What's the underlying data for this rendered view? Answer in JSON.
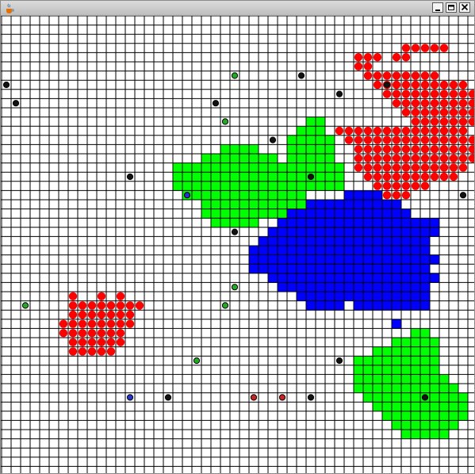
{
  "window": {
    "title": ""
  },
  "icons": {
    "app": "java-cup-icon",
    "minimize": "minimize-icon",
    "maximize": "maximize-icon",
    "close": "close-icon"
  },
  "colors": {
    "grid_line": "#000000",
    "background": "#ffffff",
    "red_agent": "#ff0000",
    "green_region": "#00ff00",
    "blue_region": "#0000ff",
    "marker_black": "#111111",
    "marker_green": "#22aa22",
    "marker_red": "#cc2222",
    "marker_blue": "#2233cc"
  },
  "grid": {
    "columns": 50,
    "rows": 48
  },
  "regions": {
    "red_top_right": [
      [
        37,
        4,
        3
      ],
      [
        41,
        4,
        2
      ],
      [
        42,
        3,
        5
      ],
      [
        37,
        5,
        2
      ],
      [
        38,
        6,
        8
      ],
      [
        39,
        7,
        10
      ],
      [
        40,
        8,
        10
      ],
      [
        41,
        9,
        10
      ],
      [
        42,
        10,
        10
      ],
      [
        43,
        11,
        10
      ],
      [
        35,
        12,
        14
      ],
      [
        36,
        13,
        14
      ],
      [
        37,
        14,
        13
      ],
      [
        37,
        15,
        13
      ],
      [
        37,
        16,
        12
      ],
      [
        38,
        17,
        10
      ],
      [
        39,
        18,
        6
      ],
      [
        40,
        19,
        3
      ]
    ],
    "red_bottom_left": [
      [
        7,
        30,
        1
      ],
      [
        10,
        30,
        1
      ],
      [
        12,
        30,
        1
      ],
      [
        7,
        31,
        8
      ],
      [
        7,
        32,
        7
      ],
      [
        6,
        33,
        8
      ],
      [
        6,
        34,
        7
      ],
      [
        7,
        35,
        6
      ],
      [
        7,
        36,
        5
      ]
    ],
    "green_top": [
      [
        32,
        11,
        2
      ],
      [
        31,
        12,
        3
      ],
      [
        30,
        13,
        5
      ],
      [
        23,
        14,
        4
      ],
      [
        30,
        14,
        5
      ],
      [
        21,
        15,
        8
      ],
      [
        30,
        15,
        5
      ],
      [
        18,
        16,
        18
      ],
      [
        18,
        17,
        18
      ],
      [
        18,
        18,
        18
      ],
      [
        19,
        19,
        13
      ],
      [
        21,
        20,
        11
      ],
      [
        21,
        21,
        9
      ],
      [
        22,
        22,
        5
      ]
    ],
    "green_bottom_right": [
      [
        43,
        34,
        2
      ],
      [
        41,
        35,
        5
      ],
      [
        39,
        36,
        7
      ],
      [
        37,
        37,
        9
      ],
      [
        37,
        38,
        9
      ],
      [
        37,
        39,
        10
      ],
      [
        37,
        40,
        11
      ],
      [
        38,
        41,
        11
      ],
      [
        39,
        42,
        10
      ],
      [
        40,
        43,
        9
      ],
      [
        41,
        44,
        7
      ],
      [
        42,
        45,
        5
      ]
    ],
    "blue": [
      [
        36,
        19,
        4
      ],
      [
        32,
        20,
        10
      ],
      [
        30,
        21,
        13
      ],
      [
        29,
        22,
        17
      ],
      [
        28,
        23,
        18
      ],
      [
        27,
        24,
        18
      ],
      [
        26,
        25,
        19
      ],
      [
        26,
        26,
        20
      ],
      [
        26,
        27,
        19
      ],
      [
        28,
        28,
        18
      ],
      [
        29,
        29,
        16
      ],
      [
        31,
        30,
        14
      ],
      [
        32,
        31,
        4
      ],
      [
        37,
        31,
        8
      ],
      [
        41,
        33,
        1
      ]
    ]
  },
  "markers": [
    {
      "c": 0,
      "r": 7,
      "kind": "black"
    },
    {
      "c": 1,
      "r": 9,
      "kind": "black"
    },
    {
      "c": 24,
      "r": 6,
      "kind": "green"
    },
    {
      "c": 31,
      "r": 6,
      "kind": "black"
    },
    {
      "c": 22,
      "r": 9,
      "kind": "black"
    },
    {
      "c": 35,
      "r": 8,
      "kind": "black"
    },
    {
      "c": 40,
      "r": 7,
      "kind": "black"
    },
    {
      "c": 23,
      "r": 11,
      "kind": "green"
    },
    {
      "c": 28,
      "r": 13,
      "kind": "black"
    },
    {
      "c": 13,
      "r": 17,
      "kind": "black"
    },
    {
      "c": 32,
      "r": 17,
      "kind": "black"
    },
    {
      "c": 19,
      "r": 19,
      "kind": "blue"
    },
    {
      "c": 48,
      "r": 19,
      "kind": "black"
    },
    {
      "c": 24,
      "r": 23,
      "kind": "black"
    },
    {
      "c": 24,
      "r": 29,
      "kind": "green"
    },
    {
      "c": 2,
      "r": 31,
      "kind": "green"
    },
    {
      "c": 23,
      "r": 31,
      "kind": "green"
    },
    {
      "c": 20,
      "r": 37,
      "kind": "green"
    },
    {
      "c": 35,
      "r": 37,
      "kind": "black"
    },
    {
      "c": 13,
      "r": 41,
      "kind": "blue"
    },
    {
      "c": 17,
      "r": 41,
      "kind": "black"
    },
    {
      "c": 26,
      "r": 41,
      "kind": "red"
    },
    {
      "c": 29,
      "r": 41,
      "kind": "red"
    },
    {
      "c": 32,
      "r": 41,
      "kind": "black"
    },
    {
      "c": 44,
      "r": 41,
      "kind": "black"
    }
  ]
}
